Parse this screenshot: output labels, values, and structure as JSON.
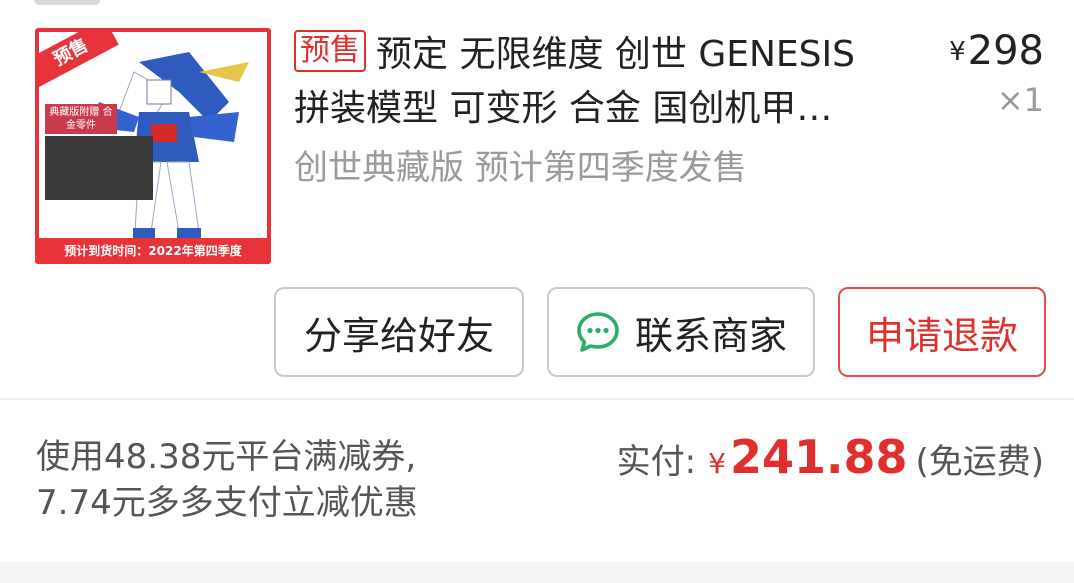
{
  "order": {
    "product_image": {
      "tag": "预售",
      "note": "典藏版附赠 合金零件",
      "footer": "预计到货时间：2022年第四季度"
    },
    "badge": "预售",
    "title_line1": "预定 无限维度 创世 GENESIS",
    "title_line2": "拼装模型 可变形 合金 国创机甲…",
    "spec": "创世典藏版 预计第四季度发售",
    "price_symbol": "¥",
    "price": "298",
    "quantity": "×1",
    "buttons": {
      "share": "分享给好友",
      "contact": "联系商家",
      "refund": "申请退款"
    }
  },
  "summary": {
    "discount_line1": "使用48.38元平台满减券,",
    "discount_line2": "7.74元多多支付立减优惠",
    "paid_label": "实付:",
    "paid_symbol": "¥",
    "paid_amount": "241.88",
    "shipping": "(免运费)"
  },
  "colors": {
    "accent_red": "#e0302d",
    "wechat_green": "#2aae67"
  },
  "icons": {
    "contact": "chat-bubble-icon"
  }
}
